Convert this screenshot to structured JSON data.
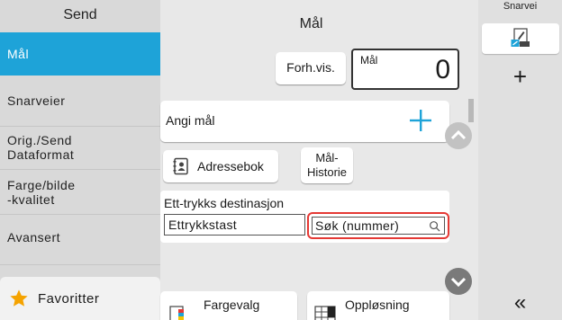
{
  "sidebar": {
    "header": "Send",
    "items": [
      {
        "label": "Mål"
      },
      {
        "label": "Snarveier"
      },
      {
        "label_line1": "Orig./Send",
        "label_line2": "Dataformat"
      },
      {
        "label_line1": "Farge/bilde",
        "label_line2": "-kvalitet"
      },
      {
        "label": "Avansert"
      }
    ],
    "favorites": "Favoritter"
  },
  "main": {
    "title": "Mål",
    "preview_button": "Forh.vis.",
    "dest_count_label": "Mål",
    "dest_count": "0",
    "add_destination": "Angi mål",
    "addressbook_button": "Adressebok",
    "history_line1": "Mål-",
    "history_line2": "Historie",
    "onetouch_label": "Ett-trykks destinasjon",
    "onetouch_key": "Ettrykkstast",
    "onetouch_search": "Søk (nummer)",
    "func_color": "Fargevalg",
    "func_resolution": "Oppløsning"
  },
  "right": {
    "header": "Snarvei",
    "plus": "+",
    "collapse": "«"
  },
  "colors": {
    "accent": "#1ea3d8",
    "highlight": "#e53935",
    "star": "#f5a300"
  }
}
